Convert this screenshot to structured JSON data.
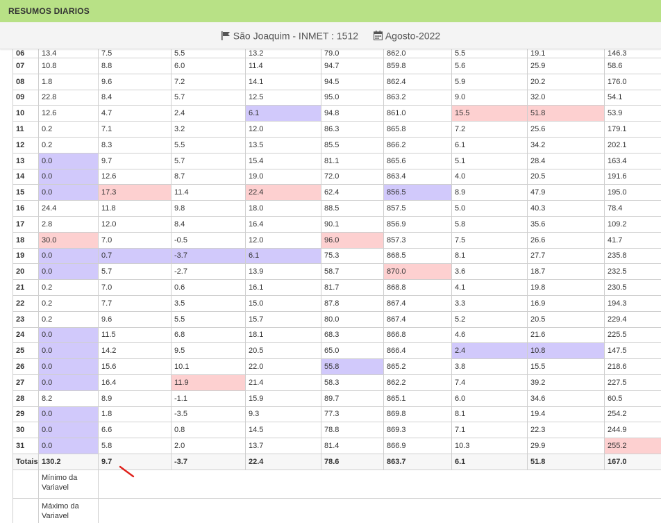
{
  "header": {
    "title": "RESUMOS DIARIOS",
    "station": "São Joaquim - INMET : 1512",
    "period": "Agosto-2022",
    "station_icon": "flag-icon",
    "period_icon": "calendar-icon"
  },
  "colors": {
    "header_bg": "#b8e186",
    "min_highlight": "#d1c9fb",
    "max_highlight": "#fdd0d0"
  },
  "partial_row": [
    "06",
    "13.4",
    "7.5",
    "5.5",
    "13.2",
    "79.0",
    "862.0",
    "5.5",
    "19.1",
    "146.3"
  ],
  "rows": [
    {
      "cells": [
        "07",
        "10.8",
        "8.8",
        "6.0",
        "11.4",
        "94.7",
        "859.8",
        "5.6",
        "25.9",
        "58.6"
      ],
      "hl": [
        "",
        "",
        "",
        "",
        "",
        "",
        "",
        "",
        "",
        ""
      ]
    },
    {
      "cells": [
        "08",
        "1.8",
        "9.6",
        "7.2",
        "14.1",
        "94.5",
        "862.4",
        "5.9",
        "20.2",
        "176.0"
      ],
      "hl": [
        "",
        "",
        "",
        "",
        "",
        "",
        "",
        "",
        "",
        ""
      ]
    },
    {
      "cells": [
        "09",
        "22.8",
        "8.4",
        "5.7",
        "12.5",
        "95.0",
        "863.2",
        "9.0",
        "32.0",
        "54.1"
      ],
      "hl": [
        "",
        "",
        "",
        "",
        "",
        "",
        "",
        "",
        "",
        ""
      ]
    },
    {
      "cells": [
        "10",
        "12.6",
        "4.7",
        "2.4",
        "6.1",
        "94.8",
        "861.0",
        "15.5",
        "51.8",
        "53.9"
      ],
      "hl": [
        "",
        "",
        "",
        "",
        "min",
        "",
        "",
        "max",
        "max",
        ""
      ]
    },
    {
      "cells": [
        "11",
        "0.2",
        "7.1",
        "3.2",
        "12.0",
        "86.3",
        "865.8",
        "7.2",
        "25.6",
        "179.1"
      ],
      "hl": [
        "",
        "",
        "",
        "",
        "",
        "",
        "",
        "",
        "",
        ""
      ]
    },
    {
      "cells": [
        "12",
        "0.2",
        "8.3",
        "5.5",
        "13.5",
        "85.5",
        "866.2",
        "6.1",
        "34.2",
        "202.1"
      ],
      "hl": [
        "",
        "",
        "",
        "",
        "",
        "",
        "",
        "",
        "",
        ""
      ]
    },
    {
      "cells": [
        "13",
        "0.0",
        "9.7",
        "5.7",
        "15.4",
        "81.1",
        "865.6",
        "5.1",
        "28.4",
        "163.4"
      ],
      "hl": [
        "",
        "min",
        "",
        "",
        "",
        "",
        "",
        "",
        "",
        ""
      ]
    },
    {
      "cells": [
        "14",
        "0.0",
        "12.6",
        "8.7",
        "19.0",
        "72.0",
        "863.4",
        "4.0",
        "20.5",
        "191.6"
      ],
      "hl": [
        "",
        "min",
        "",
        "",
        "",
        "",
        "",
        "",
        "",
        ""
      ]
    },
    {
      "cells": [
        "15",
        "0.0",
        "17.3",
        "11.4",
        "22.4",
        "62.4",
        "856.5",
        "8.9",
        "47.9",
        "195.0"
      ],
      "hl": [
        "",
        "min",
        "max",
        "",
        "max",
        "",
        "min",
        "",
        "",
        ""
      ]
    },
    {
      "cells": [
        "16",
        "24.4",
        "11.8",
        "9.8",
        "18.0",
        "88.5",
        "857.5",
        "5.0",
        "40.3",
        "78.4"
      ],
      "hl": [
        "",
        "",
        "",
        "",
        "",
        "",
        "",
        "",
        "",
        ""
      ]
    },
    {
      "cells": [
        "17",
        "2.8",
        "12.0",
        "8.4",
        "16.4",
        "90.1",
        "856.9",
        "5.8",
        "35.6",
        "109.2"
      ],
      "hl": [
        "",
        "",
        "",
        "",
        "",
        "",
        "",
        "",
        "",
        ""
      ]
    },
    {
      "cells": [
        "18",
        "30.0",
        "7.0",
        "-0.5",
        "12.0",
        "96.0",
        "857.3",
        "7.5",
        "26.6",
        "41.7"
      ],
      "hl": [
        "",
        "max",
        "",
        "",
        "",
        "max",
        "",
        "",
        "",
        ""
      ]
    },
    {
      "cells": [
        "19",
        "0.0",
        "0.7",
        "-3.7",
        "6.1",
        "75.3",
        "868.5",
        "8.1",
        "27.7",
        "235.8"
      ],
      "hl": [
        "",
        "min",
        "min",
        "min",
        "min",
        "",
        "",
        "",
        "",
        ""
      ]
    },
    {
      "cells": [
        "20",
        "0.0",
        "5.7",
        "-2.7",
        "13.9",
        "58.7",
        "870.0",
        "3.6",
        "18.7",
        "232.5"
      ],
      "hl": [
        "",
        "min",
        "",
        "",
        "",
        "",
        "max",
        "",
        "",
        ""
      ]
    },
    {
      "cells": [
        "21",
        "0.2",
        "7.0",
        "0.6",
        "16.1",
        "81.7",
        "868.8",
        "4.1",
        "19.8",
        "230.5"
      ],
      "hl": [
        "",
        "",
        "",
        "",
        "",
        "",
        "",
        "",
        "",
        ""
      ]
    },
    {
      "cells": [
        "22",
        "0.2",
        "7.7",
        "3.5",
        "15.0",
        "87.8",
        "867.4",
        "3.3",
        "16.9",
        "194.3"
      ],
      "hl": [
        "",
        "",
        "",
        "",
        "",
        "",
        "",
        "",
        "",
        ""
      ]
    },
    {
      "cells": [
        "23",
        "0.2",
        "9.6",
        "5.5",
        "15.7",
        "80.0",
        "867.4",
        "5.2",
        "20.5",
        "229.4"
      ],
      "hl": [
        "",
        "",
        "",
        "",
        "",
        "",
        "",
        "",
        "",
        ""
      ]
    },
    {
      "cells": [
        "24",
        "0.0",
        "11.5",
        "6.8",
        "18.1",
        "68.3",
        "866.8",
        "4.6",
        "21.6",
        "225.5"
      ],
      "hl": [
        "",
        "min",
        "",
        "",
        "",
        "",
        "",
        "",
        "",
        ""
      ]
    },
    {
      "cells": [
        "25",
        "0.0",
        "14.2",
        "9.5",
        "20.5",
        "65.0",
        "866.4",
        "2.4",
        "10.8",
        "147.5"
      ],
      "hl": [
        "",
        "min",
        "",
        "",
        "",
        "",
        "",
        "min",
        "min",
        ""
      ]
    },
    {
      "cells": [
        "26",
        "0.0",
        "15.6",
        "10.1",
        "22.0",
        "55.8",
        "865.2",
        "3.8",
        "15.5",
        "218.6"
      ],
      "hl": [
        "",
        "min",
        "",
        "",
        "",
        "min",
        "",
        "",
        "",
        ""
      ]
    },
    {
      "cells": [
        "27",
        "0.0",
        "16.4",
        "11.9",
        "21.4",
        "58.3",
        "862.2",
        "7.4",
        "39.2",
        "227.5"
      ],
      "hl": [
        "",
        "min",
        "",
        "max",
        "",
        "",
        "",
        "",
        "",
        ""
      ]
    },
    {
      "cells": [
        "28",
        "8.2",
        "8.9",
        "-1.1",
        "15.9",
        "89.7",
        "865.1",
        "6.0",
        "34.6",
        "60.5"
      ],
      "hl": [
        "",
        "",
        "",
        "",
        "",
        "",
        "",
        "",
        "",
        ""
      ]
    },
    {
      "cells": [
        "29",
        "0.0",
        "1.8",
        "-3.5",
        "9.3",
        "77.3",
        "869.8",
        "8.1",
        "19.4",
        "254.2"
      ],
      "hl": [
        "",
        "min",
        "",
        "",
        "",
        "",
        "",
        "",
        "",
        ""
      ]
    },
    {
      "cells": [
        "30",
        "0.0",
        "6.6",
        "0.8",
        "14.5",
        "78.8",
        "869.3",
        "7.1",
        "22.3",
        "244.9"
      ],
      "hl": [
        "",
        "min",
        "",
        "",
        "",
        "",
        "",
        "",
        "",
        ""
      ]
    },
    {
      "cells": [
        "31",
        "0.0",
        "5.8",
        "2.0",
        "13.7",
        "81.4",
        "866.9",
        "10.3",
        "29.9",
        "255.2"
      ],
      "hl": [
        "",
        "min",
        "",
        "",
        "",
        "",
        "",
        "",
        "",
        "max"
      ]
    }
  ],
  "totals": [
    "Totais",
    "130.2",
    "9.7",
    "-3.7",
    "22.4",
    "78.6",
    "863.7",
    "6.1",
    "51.8",
    "167.0"
  ],
  "legend": {
    "min_label": "Mínimo da Variavel",
    "max_label": "Máximo da Variavel"
  }
}
